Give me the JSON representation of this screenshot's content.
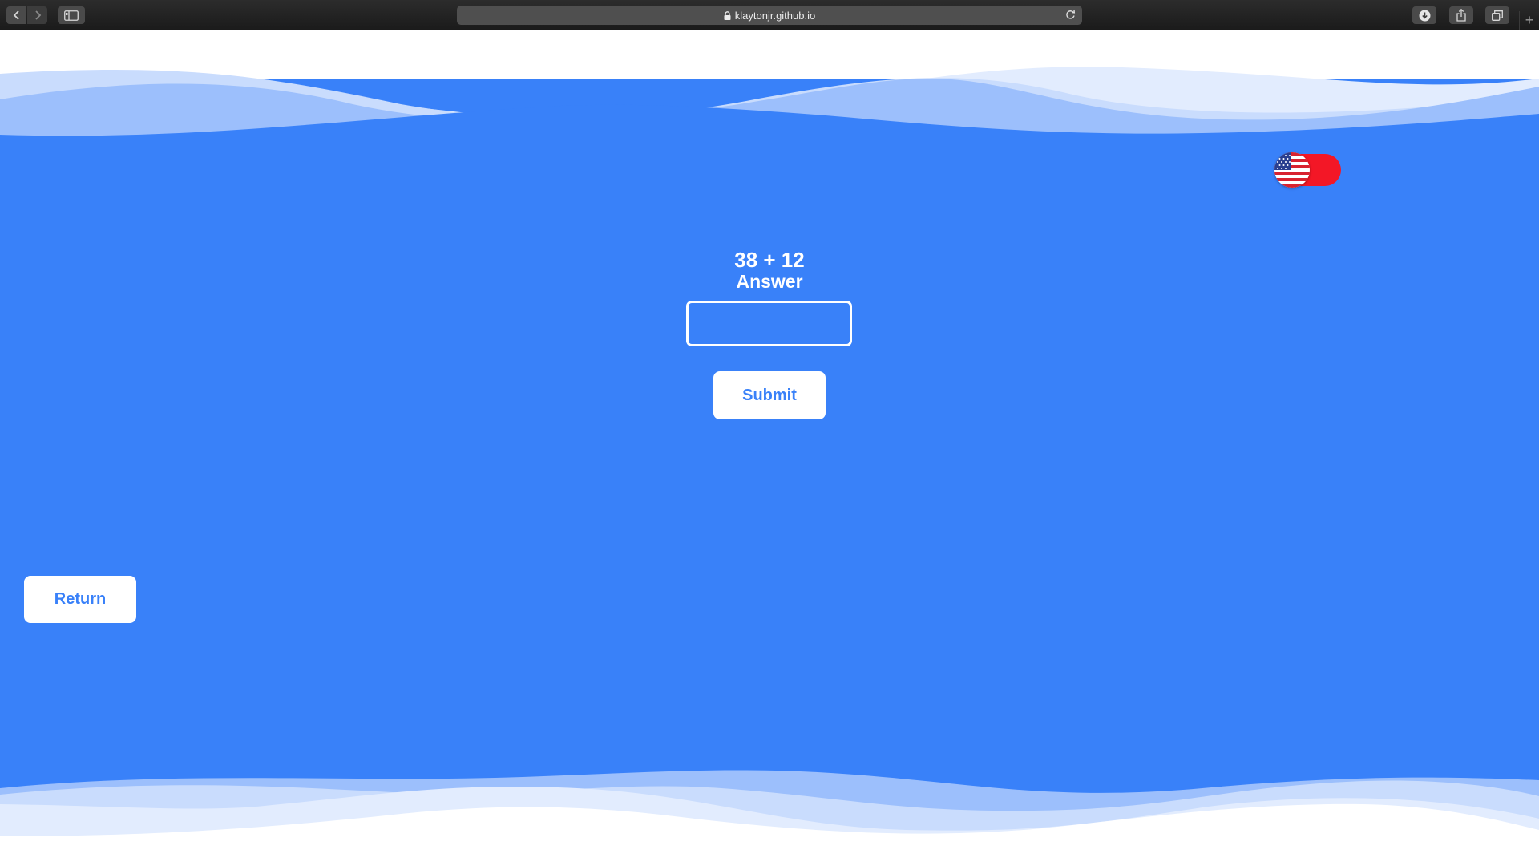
{
  "browser": {
    "url": "klaytonjr.github.io",
    "new_tab": "+"
  },
  "icons": {
    "back": "chevron-left-icon",
    "forward": "chevron-right-icon",
    "sidebar": "sidebar-icon",
    "lock": "lock-icon",
    "reload": "reload-icon",
    "downloads": "download-icon",
    "share": "share-icon",
    "tabs": "tabs-overview-icon",
    "language": "us-flag-icon"
  },
  "colors": {
    "background_blue": "#3981f9",
    "button_text": "#3981f9",
    "toggle_red": "#f31726",
    "text_white": "#ffffff"
  },
  "quiz": {
    "question": "38 + 12",
    "answer_label": "Answer",
    "answer_value": "",
    "submit_label": "Submit"
  },
  "navigation": {
    "return_label": "Return"
  }
}
